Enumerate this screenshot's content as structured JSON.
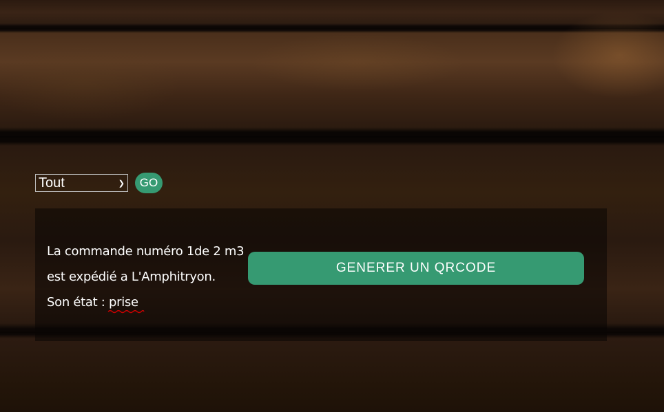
{
  "filter": {
    "selected": "Tout",
    "go_label": "GO"
  },
  "order": {
    "line1": "La commande numéro 1de 2 m3",
    "line2": "est expédié a L'Amphitryon.",
    "status_prefix": "Son état :",
    "status_value": "prise"
  },
  "qrcode_button_label": "GENERER UN QRCODE",
  "colors": {
    "accent": "#369a72",
    "spellcheck_underline": "#d40000"
  }
}
